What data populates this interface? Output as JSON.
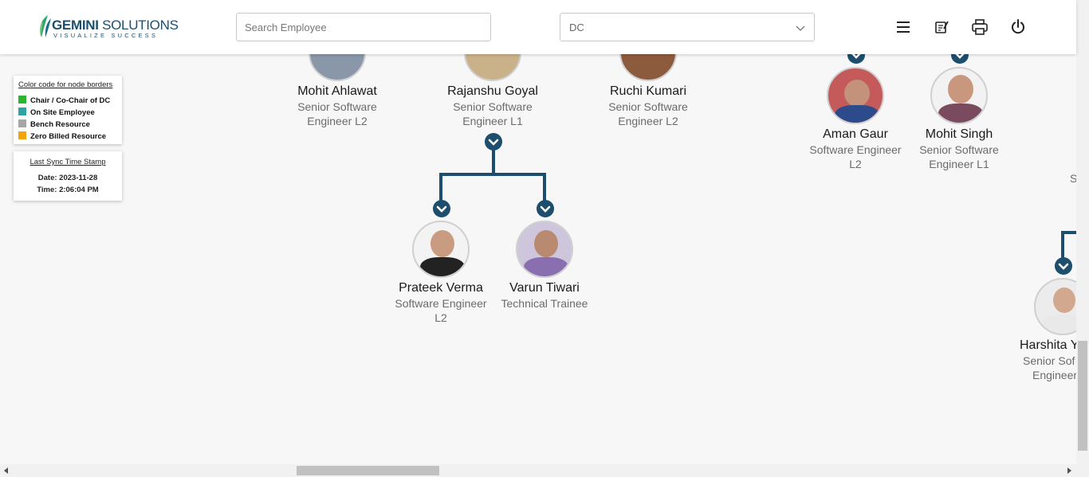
{
  "header": {
    "brand_strong": "GEMINI",
    "brand_rest": " SOLUTIONS",
    "tagline": "VISUALIZE SUCCESS",
    "search_placeholder": "Search Employee",
    "department_selected": "DC",
    "icons": [
      "menu-icon",
      "notes-icon",
      "print-icon",
      "power-icon"
    ]
  },
  "legend": {
    "title": "Color code for node borders",
    "items": [
      {
        "label": "Chair / Co-Chair of DC",
        "color": "#2db52d"
      },
      {
        "label": "On Site Employee",
        "color": "#2ea3a3"
      },
      {
        "label": "Bench Resource",
        "color": "#a6a6a6"
      },
      {
        "label": "Zero Billed Resource",
        "color": "#f5a30b"
      }
    ]
  },
  "sync": {
    "title": "Last Sync Time Stamp",
    "date": "Date: 2023-11-28",
    "time": "Time: 2:06:04 PM"
  },
  "tree": {
    "accent": "#1d4e6e",
    "nodes": [
      {
        "name": "Mohit Ahlawat",
        "role": [
          "Senior Software",
          "Engineer L2"
        ]
      },
      {
        "name": "Rajanshu Goyal",
        "role": [
          "Senior Software",
          "Engineer L1"
        ]
      },
      {
        "name": "Ruchi Kumari",
        "role": [
          "Senior Software",
          "Engineer L2"
        ]
      },
      {
        "name": "Aman Gaur",
        "role": [
          "Software Engineer",
          "L2"
        ]
      },
      {
        "name": "Mohit Singh",
        "role": [
          "Senior Software",
          "Engineer L1"
        ]
      },
      {
        "name": "Prateek Verma",
        "role": [
          "Software Engineer",
          "L2"
        ]
      },
      {
        "name": "Varun Tiwari",
        "role": [
          "Technical Trainee"
        ]
      },
      {
        "name": "Harshita Y",
        "role": [
          "Senior Sof",
          "Engineer"
        ]
      }
    ],
    "offscreen_fragment": "S"
  }
}
